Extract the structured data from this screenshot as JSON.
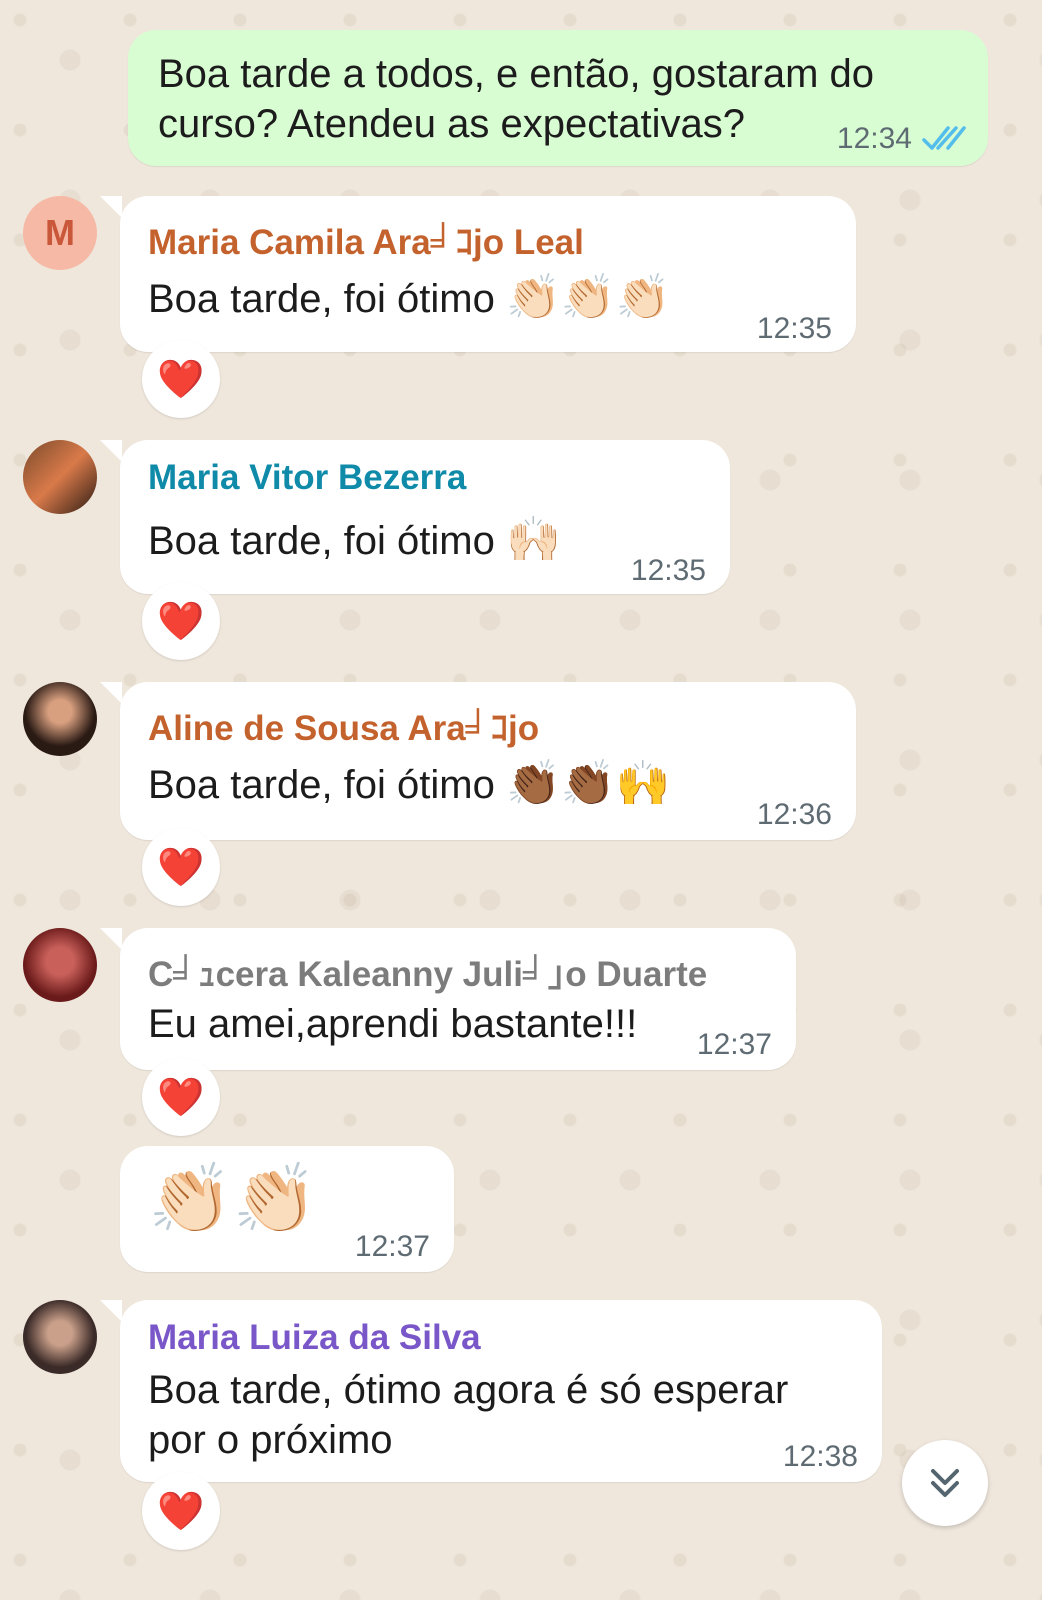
{
  "outgoing": {
    "line1": "Boa tarde a todos,  e então,  gostaram do",
    "line2": "curso? Atendeu as expectativas?",
    "time": "12:34"
  },
  "messages": [
    {
      "sender": "Maria Camila Ara╛ｺjo Leal",
      "sender_color": "#c4622d",
      "avatar_letter": "M",
      "text": "Boa tarde, foi ótimo",
      "emoji": "👏🏻👏🏻👏🏻",
      "time": "12:35",
      "reaction": "❤️"
    },
    {
      "sender": "Maria Vitor Bezerra",
      "sender_color": "#0f8aa8",
      "text": "Boa tarde, foi ótimo",
      "emoji": "🙌🏻",
      "time": "12:35",
      "reaction": "❤️"
    },
    {
      "sender": "Aline de Sousa Ara╛ｺjo",
      "sender_color": "#c4622d",
      "text": "Boa tarde, foi ótimo",
      "emoji": "👏🏾👏🏾🙌",
      "time": "12:36",
      "reaction": "❤️"
    },
    {
      "sender": "C╛ｭcera Kaleanny Juli╛｣o Duarte",
      "sender_color": "#7c7c7c",
      "text": "Eu amei,aprendi bastante!!!",
      "time": "12:37",
      "reaction": "❤️"
    },
    {
      "emoji": "👏🏻👏🏻",
      "time": "12:37"
    },
    {
      "sender": "Maria Luiza da Silva",
      "sender_color": "#7a57c9",
      "text_line1": "Boa tarde, ótimo agora é só esperar",
      "text_line2": "por o próximo",
      "time": "12:38",
      "reaction": "❤️"
    }
  ],
  "icons": {
    "read_receipt": "double-check-icon",
    "scroll_down": "chevron-double-down-icon"
  },
  "colors": {
    "outgoing_bubble": "#d9fdd3",
    "incoming_bubble": "#ffffff",
    "read_check": "#53bdeb",
    "wallpaper": "#efe7dc"
  }
}
